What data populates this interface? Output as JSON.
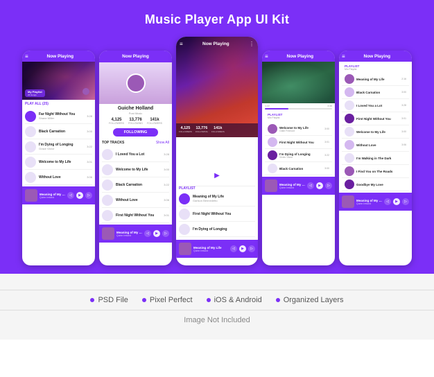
{
  "title": "Music Player App UI Kit",
  "phones": {
    "phone1": {
      "header": "Now Playing",
      "playlist_label": "My Playlist",
      "playlist_sub": "25 Songs",
      "play_all": "PLAY ALL (25)",
      "songs": [
        {
          "name": "Far Night Without You",
          "artist": "Shane Miller",
          "duration": "3:28",
          "active": true
        },
        {
          "name": "Black Carnation",
          "artist": "",
          "duration": "3:00"
        },
        {
          "name": "I'm Dying of Longing",
          "artist": "Grace Victor",
          "duration": "3:22"
        },
        {
          "name": "Welcome to My Life",
          "artist": "",
          "duration": "3:01"
        },
        {
          "name": "Without Love",
          "artist": "",
          "duration": "3:06"
        },
        {
          "name": "Meaning of My Life",
          "artist": "Quinn Ireland",
          "duration": "",
          "active_bottom": true
        }
      ],
      "player": {
        "song": "Meaning of My Life",
        "artist": "Quinn Ireland"
      }
    },
    "phone2": {
      "header": "Now Playing",
      "artist_name": "Guiche Holland",
      "artist_sub": "Post Music",
      "stats": [
        {
          "num": "4,125",
          "label": "FOLLOWERS"
        },
        {
          "num": "13,776",
          "label": "FOLLOWING"
        },
        {
          "num": "141k",
          "label": "FOLLOWERS"
        }
      ],
      "follow_btn": "FOLLOWING",
      "top_tracks": "TOP TRACKS",
      "show_all": "Show All",
      "tracks": [
        {
          "name": "I Loved You a Lot",
          "duration": "3:28"
        },
        {
          "name": "Welcome to My Life",
          "duration": "3:00"
        },
        {
          "name": "Black Carnation",
          "duration": "3:22"
        },
        {
          "name": "Without Love",
          "duration": "3:06"
        },
        {
          "name": "First Night Without You",
          "duration": "3:01"
        }
      ],
      "player": {
        "song": "Meaning of My Life",
        "artist": "Quinn Ireland"
      }
    },
    "phone3": {
      "header": "Now Playing",
      "stats": [
        {
          "num": "4,125",
          "label": "FOLLOWERS"
        },
        {
          "num": "13,776",
          "label": "FOLLOWING"
        },
        {
          "num": "141k",
          "label": "FOLLOWERS"
        }
      ],
      "song_title": "Meaning of My Life",
      "artist": "Guiche Holland",
      "playlist_label": "PLAYLIST",
      "playlist_sub": "Mix Playlist",
      "songs": [
        {
          "name": "Welcome to My Life",
          "artist": "Garison Bennedetto"
        },
        {
          "name": "First Night Without You",
          "artist": "Odo Franco"
        },
        {
          "name": "I'm Dying of Longing",
          "artist": "Vivien Victor"
        },
        {
          "name": "Black Carnation",
          "artist": ""
        }
      ],
      "player": {
        "song": "Meaning of My Life",
        "artist": "Quinn Ireland"
      }
    },
    "phone4": {
      "header": "Now Playing",
      "playlist_label": "PLAYLIST",
      "playlist_sub": "Mix Playlist",
      "songs": [
        {
          "name": "Meaning of My Life",
          "artist": "",
          "duration": "2:16"
        },
        {
          "name": "Black Carnation",
          "artist": "",
          "duration": "3:00"
        },
        {
          "name": "I Loved You a Lot",
          "artist": "",
          "duration": "3:28"
        },
        {
          "name": "First Night Without You",
          "artist": "",
          "duration": "3:01"
        },
        {
          "name": "Welcome to My Life",
          "artist": "",
          "duration": "3:00"
        },
        {
          "name": "Without Love",
          "artist": "",
          "duration": "3:06"
        },
        {
          "name": "I'm Walking in The Dark",
          "artist": "",
          "duration": ""
        },
        {
          "name": "I Find You on The Roads",
          "artist": "",
          "duration": ""
        },
        {
          "name": "Goodbye My Love",
          "artist": "",
          "duration": ""
        }
      ],
      "player": {
        "song": "Meaning of My Life",
        "artist": "Quinn Ireland"
      }
    },
    "phone5": {
      "header": "Now Playing",
      "playlist_label": "PLAYLIST",
      "playlist_sub": "Mix Playlist",
      "songs": [
        {
          "name": "Meaning of My Life",
          "artist": "",
          "duration": "2:16"
        },
        {
          "name": "Black Carnation",
          "artist": "",
          "duration": "3:00"
        },
        {
          "name": "I Loved You a Lot",
          "artist": "",
          "duration": "3:28"
        },
        {
          "name": "First Night Without You",
          "artist": "",
          "duration": "3:01"
        },
        {
          "name": "Welcome to My Life",
          "artist": "",
          "duration": "3:00"
        },
        {
          "name": "Without Love",
          "artist": "",
          "duration": "3:06"
        },
        {
          "name": "I'm Walking in The Dark",
          "artist": "",
          "duration": ""
        },
        {
          "name": "I Find You on The Roads",
          "artist": "",
          "duration": ""
        },
        {
          "name": "Goodbye My Love",
          "artist": "",
          "duration": ""
        }
      ],
      "player": {
        "song": "Meaning of My Life",
        "artist": "Quinn Ireland"
      }
    }
  },
  "features": [
    "PSD File",
    "Pixel Perfect",
    "iOS & Android",
    "Organized Layers"
  ],
  "not_included": "Image Not Included",
  "accent_color": "#7b2ff7"
}
